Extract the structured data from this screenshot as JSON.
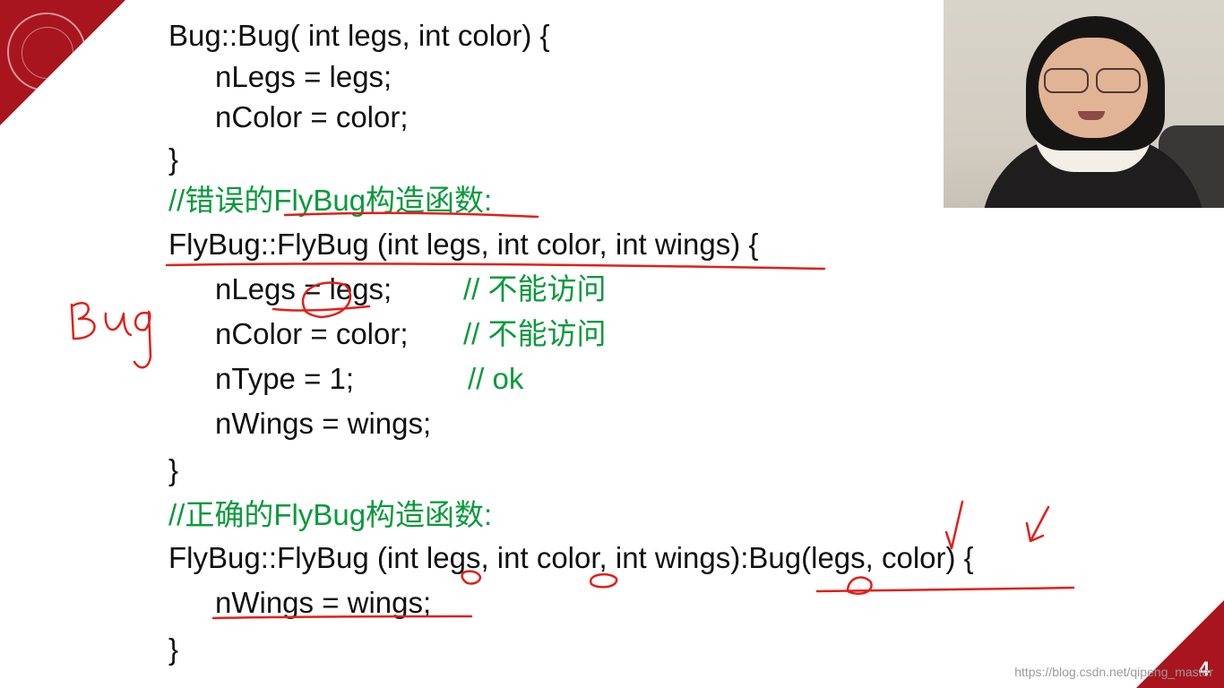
{
  "slide": {
    "page_number": "4",
    "watermark": "https://blog.csdn.net/qipeng_master",
    "accent_color": "#a8151e",
    "code_lines": [
      {
        "id": "l1",
        "text": "Bug::Bug( int legs, int color) {"
      },
      {
        "id": "l2",
        "text": "nLegs = legs;"
      },
      {
        "id": "l3",
        "text": "nColor = color;"
      },
      {
        "id": "l4",
        "text": "}"
      },
      {
        "id": "l5",
        "text": "//错误的FlyBug构造函数:"
      },
      {
        "id": "l6",
        "text": "FlyBug::FlyBug (int legs, int color, int wings) {"
      },
      {
        "id": "l7",
        "text": "nLegs = legs;"
      },
      {
        "id": "l8",
        "text": "nColor = color;"
      },
      {
        "id": "l9",
        "text": "nType = 1;"
      },
      {
        "id": "l10",
        "text": "nWings = wings;"
      },
      {
        "id": "l11",
        "text": "}"
      },
      {
        "id": "l12",
        "text": "//正确的FlyBug构造函数:"
      },
      {
        "id": "l13",
        "text": "FlyBug::FlyBug (int legs, int color, int wings):Bug(legs, color) {"
      },
      {
        "id": "l14",
        "text": "nWings = wings;"
      },
      {
        "id": "l15",
        "text": "}"
      }
    ],
    "inline_comments": {
      "l7": "// 不能访问",
      "l8": "// 不能访问",
      "l9": "// ok"
    },
    "comment_color": "#0a9a3c",
    "annotation_color": "#e0201a"
  },
  "annotations": {
    "handwritten_word": "Bug"
  },
  "webcam": {
    "icon": "presenter-video-icon"
  }
}
